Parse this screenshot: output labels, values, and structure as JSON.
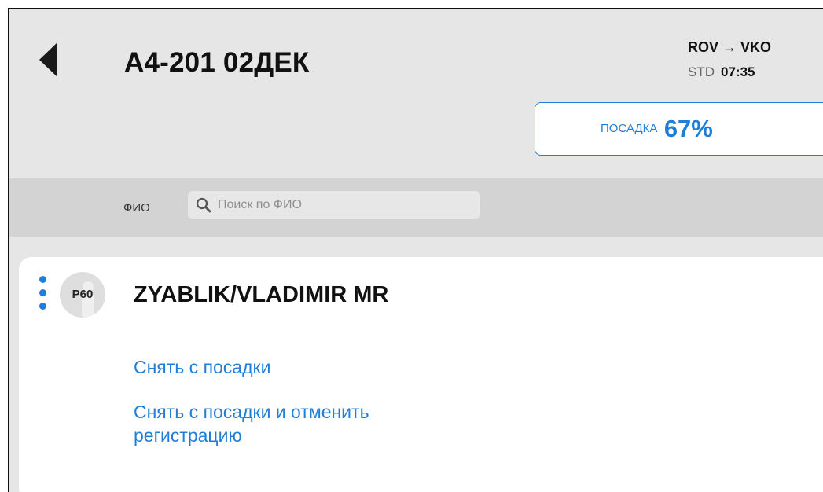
{
  "header": {
    "flight_title": "А4-201 02ДЕК",
    "route": "ROV → VKO",
    "std_label": "STD",
    "std_time": "07:35",
    "boarding_label": "ПОСАДКА",
    "boarding_percent": "67%",
    "back_icon": "chevron-left-icon"
  },
  "search": {
    "label": "ФИО",
    "placeholder": "Поиск по ФИО",
    "value": "",
    "icon": "search-icon"
  },
  "passenger": {
    "seat": "Р60",
    "name": "ZYABLIK/VLADIMIR MR",
    "actions": [
      "Снять с посадки",
      "Снять с посадки и отменить регистрацию"
    ]
  },
  "colors": {
    "accent": "#1f7fd8",
    "background": "#e6e6e6",
    "search_bar": "#d3d3d3",
    "card": "#ffffff"
  }
}
